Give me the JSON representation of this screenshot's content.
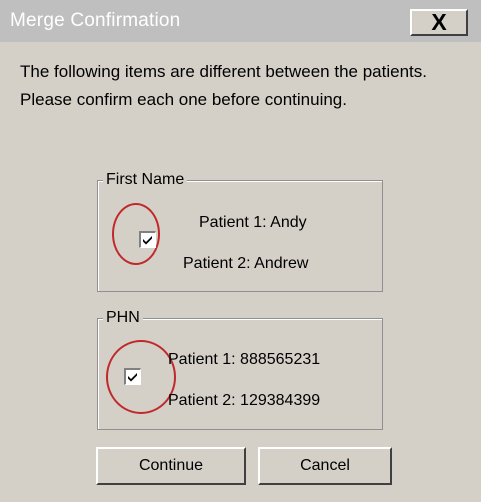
{
  "window": {
    "title": "Merge Confirmation",
    "close_glyph": "X",
    "background": "#d4d0c8",
    "titlebar_color": "#bfbfbf"
  },
  "message": "The following items are different between the patients. Please confirm each one before continuing.",
  "groups": [
    {
      "label": "First Name",
      "checked": true,
      "patient1": "Patient 1: Andy",
      "patient2": "Patient 2: Andrew"
    },
    {
      "label": "PHN",
      "checked": true,
      "patient1": "Patient 1: 888565231",
      "patient2": "Patient 2: 129384399"
    }
  ],
  "buttons": {
    "continue_label": "Continue",
    "cancel_label": "Cancel"
  },
  "annotation_color": "#c0292b"
}
